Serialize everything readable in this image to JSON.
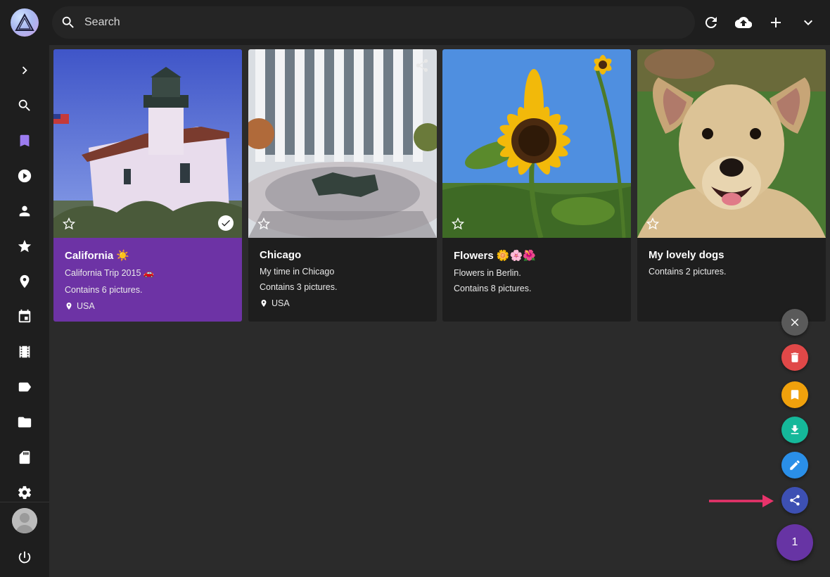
{
  "search": {
    "placeholder": "Search"
  },
  "sidebar": {
    "items": [
      {
        "icon": "chevron-right-icon"
      },
      {
        "icon": "search-icon"
      },
      {
        "icon": "bookmark-icon",
        "active": true
      },
      {
        "icon": "play-icon"
      },
      {
        "icon": "person-icon"
      },
      {
        "icon": "star-icon"
      },
      {
        "icon": "location-icon"
      },
      {
        "icon": "calendar-icon"
      },
      {
        "icon": "film-icon"
      },
      {
        "icon": "label-icon"
      },
      {
        "icon": "folder-icon"
      },
      {
        "icon": "sd-card-icon"
      },
      {
        "icon": "gear-icon"
      }
    ],
    "bottom": [
      {
        "icon": "avatar"
      },
      {
        "icon": "power-icon"
      }
    ]
  },
  "toolbar": {
    "buttons": [
      {
        "icon": "refresh-icon"
      },
      {
        "icon": "cloud-upload-icon"
      },
      {
        "icon": "plus-icon"
      },
      {
        "icon": "chevron-down-icon"
      }
    ]
  },
  "albums": [
    {
      "title": "California ☀️",
      "description": "California Trip 2015 🚗",
      "count": "Contains 6 pictures.",
      "location": "USA",
      "selected": true
    },
    {
      "title": "Chicago",
      "description": "My time in Chicago",
      "count": "Contains 3 pictures.",
      "location": "USA",
      "shared": true
    },
    {
      "title": "Flowers 🌼🌸🌺",
      "description": "Flowers in Berlin.",
      "count": "Contains 8 pictures."
    },
    {
      "title": "My lovely dogs",
      "description": "Contains 2 pictures."
    }
  ],
  "fab": {
    "actions": [
      {
        "icon": "close-icon",
        "color": "#5a5a5a"
      },
      {
        "icon": "trash-icon",
        "color": "#e04848"
      },
      {
        "icon": "bookmark-icon",
        "color": "#f0a10c"
      },
      {
        "icon": "download-icon",
        "color": "#15b89a"
      },
      {
        "icon": "pencil-icon",
        "color": "#2a8fe8"
      },
      {
        "icon": "share-icon",
        "color": "#3d50b3"
      }
    ],
    "selection_count": "1"
  },
  "colors": {
    "accent": "#6d33a5",
    "annotation_arrow": "#e8336b"
  }
}
